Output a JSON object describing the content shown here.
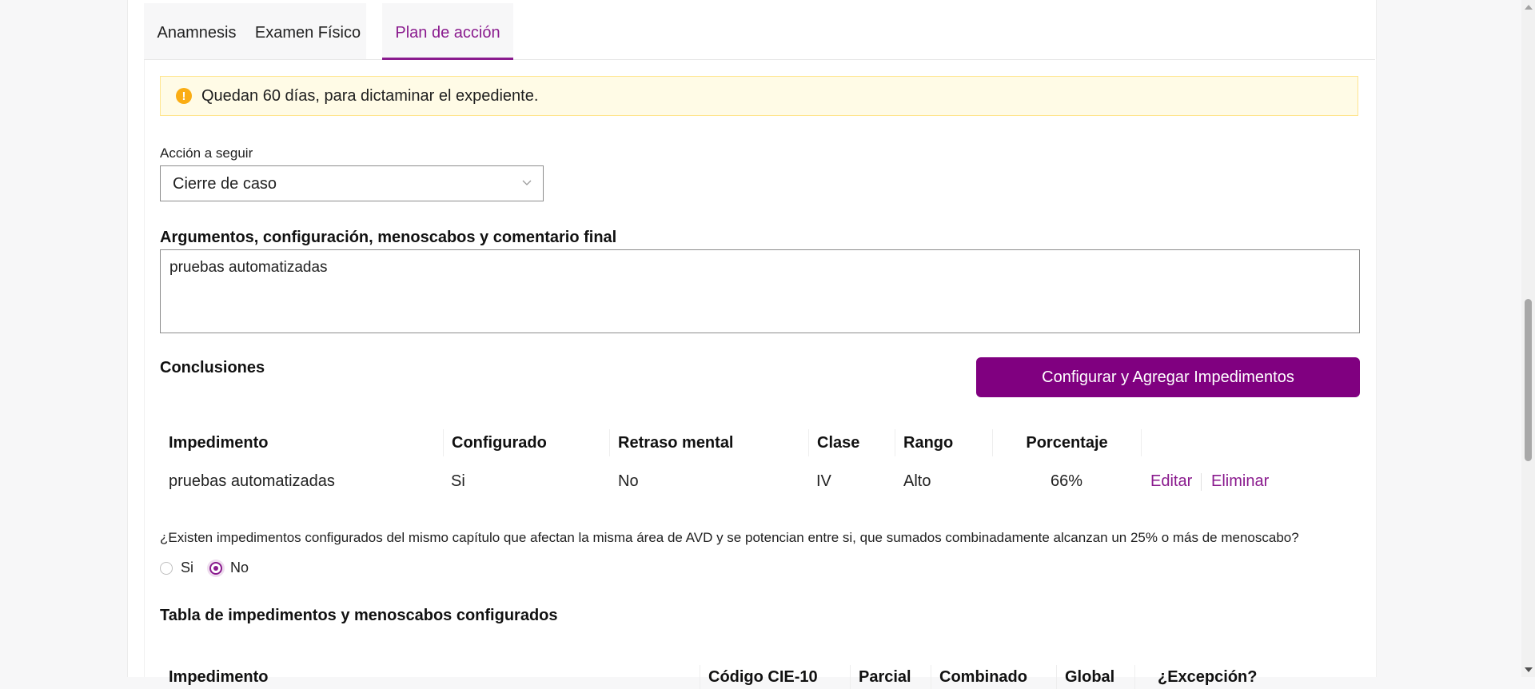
{
  "tabs": [
    {
      "label": "Anamnesis"
    },
    {
      "label": "Examen Físico"
    },
    {
      "label": "Plan de acción"
    }
  ],
  "alert": {
    "icon": "exclamation-circle-icon",
    "text": "Quedan 60 días, para dictaminar el expediente."
  },
  "action": {
    "label": "Acción a seguir",
    "value": "Cierre de caso"
  },
  "arguments": {
    "label": "Argumentos, configuración, menoscabos y comentario final",
    "value": "pruebas automatizadas"
  },
  "conclusions": {
    "title": "Conclusiones",
    "button_label": "Configurar y Agregar Impedimentos"
  },
  "impediments_table": {
    "headers": [
      "Impedimento",
      "Configurado",
      "Retraso mental",
      "Clase",
      "Rango",
      "Porcentaje"
    ],
    "rows": [
      {
        "impedimento": "pruebas automatizadas",
        "configurado": "Si",
        "retraso": "No",
        "clase": "IV",
        "rango": "Alto",
        "porcentaje": "66%",
        "edit": "Editar",
        "delete": "Eliminar"
      }
    ]
  },
  "question": {
    "text": "¿Existen impedimentos configurados del mismo capítulo que afectan la misma área de AVD y se potencian entre si, que sumados combinadamente alcanzan un 25% o más de menoscabo?",
    "options": [
      "Si",
      "No"
    ],
    "selected": "No"
  },
  "config_table": {
    "title": "Tabla de impedimentos y menoscabos configurados",
    "headers": [
      "Impedimento",
      "Código CIE-10",
      "Parcial",
      "Combinado",
      "Global",
      "¿Excepción?"
    ]
  },
  "colors": {
    "accent": "#800080",
    "alert_bg": "#fffbe6",
    "alert_icon": "#faad14"
  }
}
